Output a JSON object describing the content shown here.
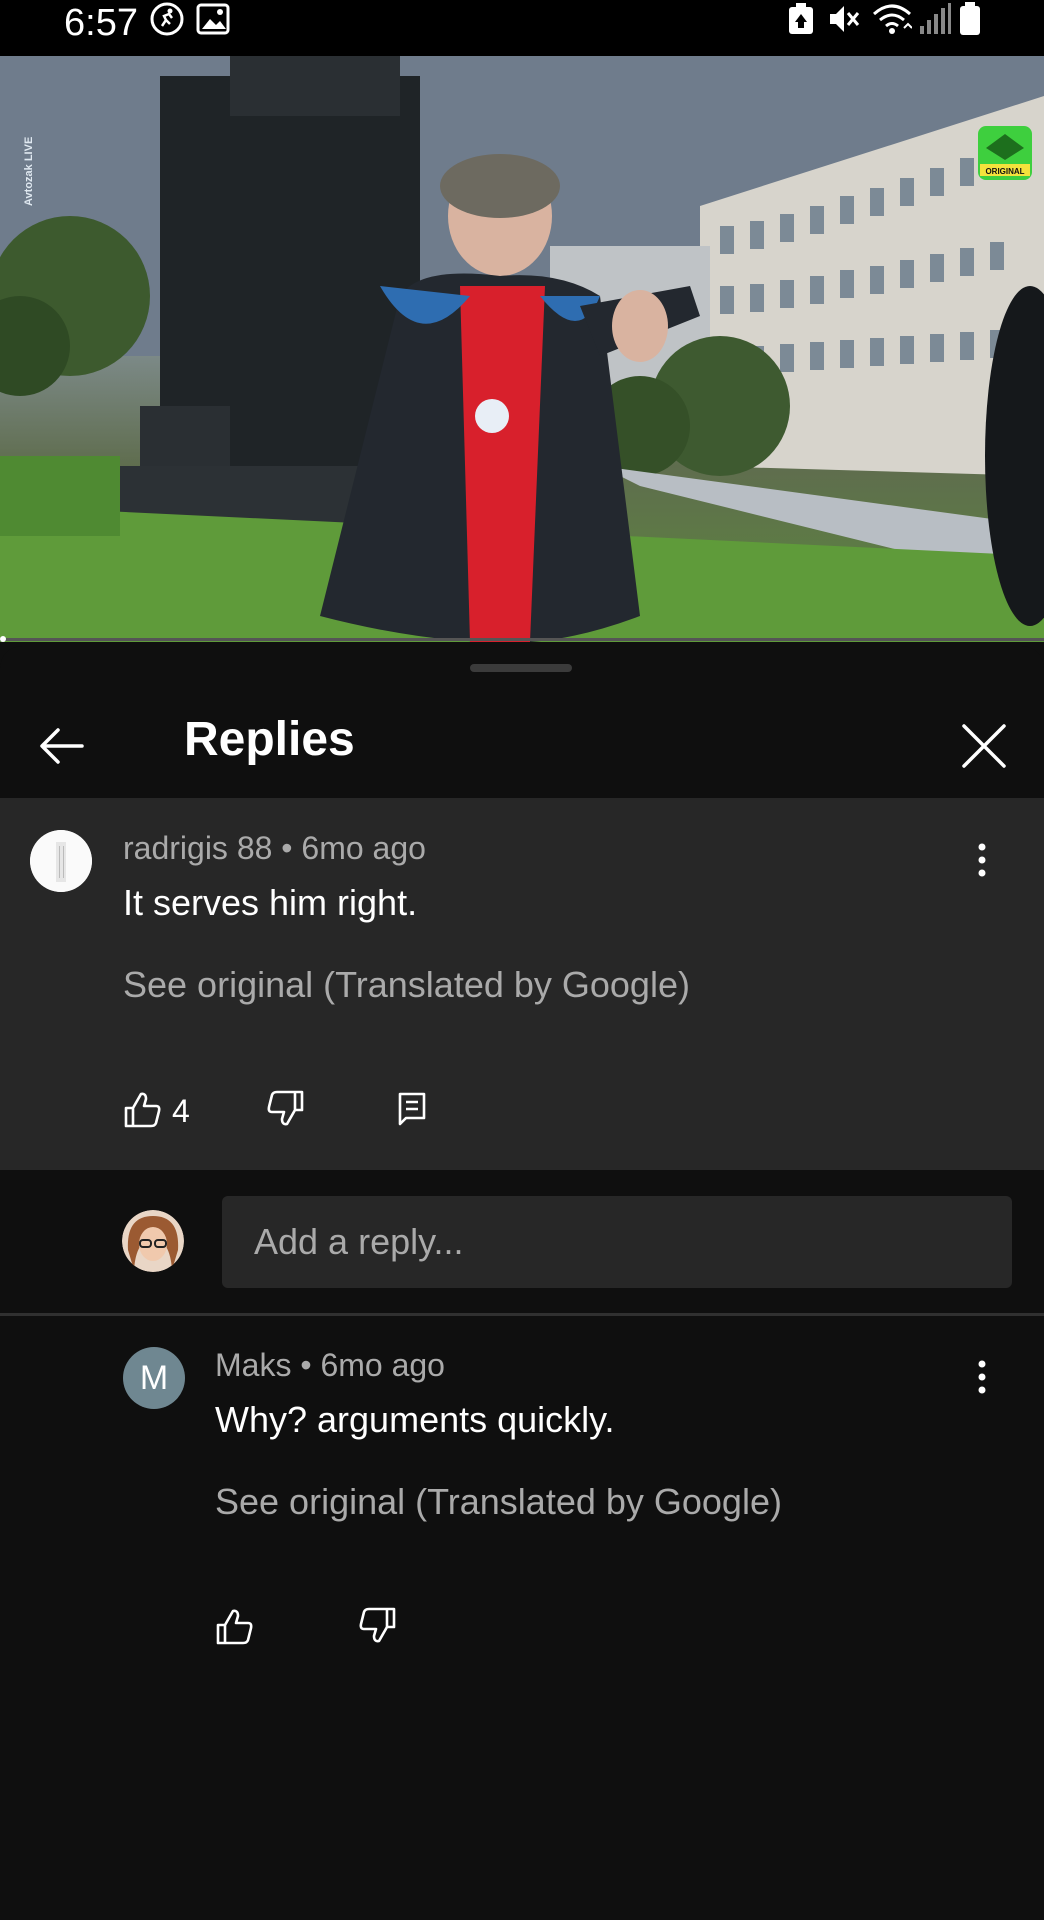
{
  "status_bar": {
    "time": "6:57",
    "icons": [
      "running-activity-icon",
      "gallery-icon",
      "battery-saver-icon",
      "mute-icon",
      "wifi-icon",
      "signal-icon",
      "battery-icon"
    ]
  },
  "video": {
    "watermark_text": "Avtozak LIVE",
    "badge_text": "ORIGINAL",
    "badge_color": "#3ecf3e"
  },
  "sheet": {
    "title": "Replies",
    "back_icon": "arrow-back-icon",
    "close_icon": "close-icon"
  },
  "parent_comment": {
    "author": "radrigis 88",
    "age": "6mo ago",
    "text": "It serves him right.",
    "see_original": "See original (Translated by Google)",
    "like_count": "4"
  },
  "reply_box": {
    "placeholder": "Add a reply..."
  },
  "replies": [
    {
      "avatar_letter": "M",
      "author": "Maks",
      "age": "6mo ago",
      "text": "Why? arguments quickly.",
      "see_original": "See original (Translated by Google)"
    }
  ],
  "colors": {
    "background": "#0f0f0f",
    "card": "#272727",
    "secondary_text": "#aaaaaa",
    "avatar_m": "#6f8791"
  }
}
